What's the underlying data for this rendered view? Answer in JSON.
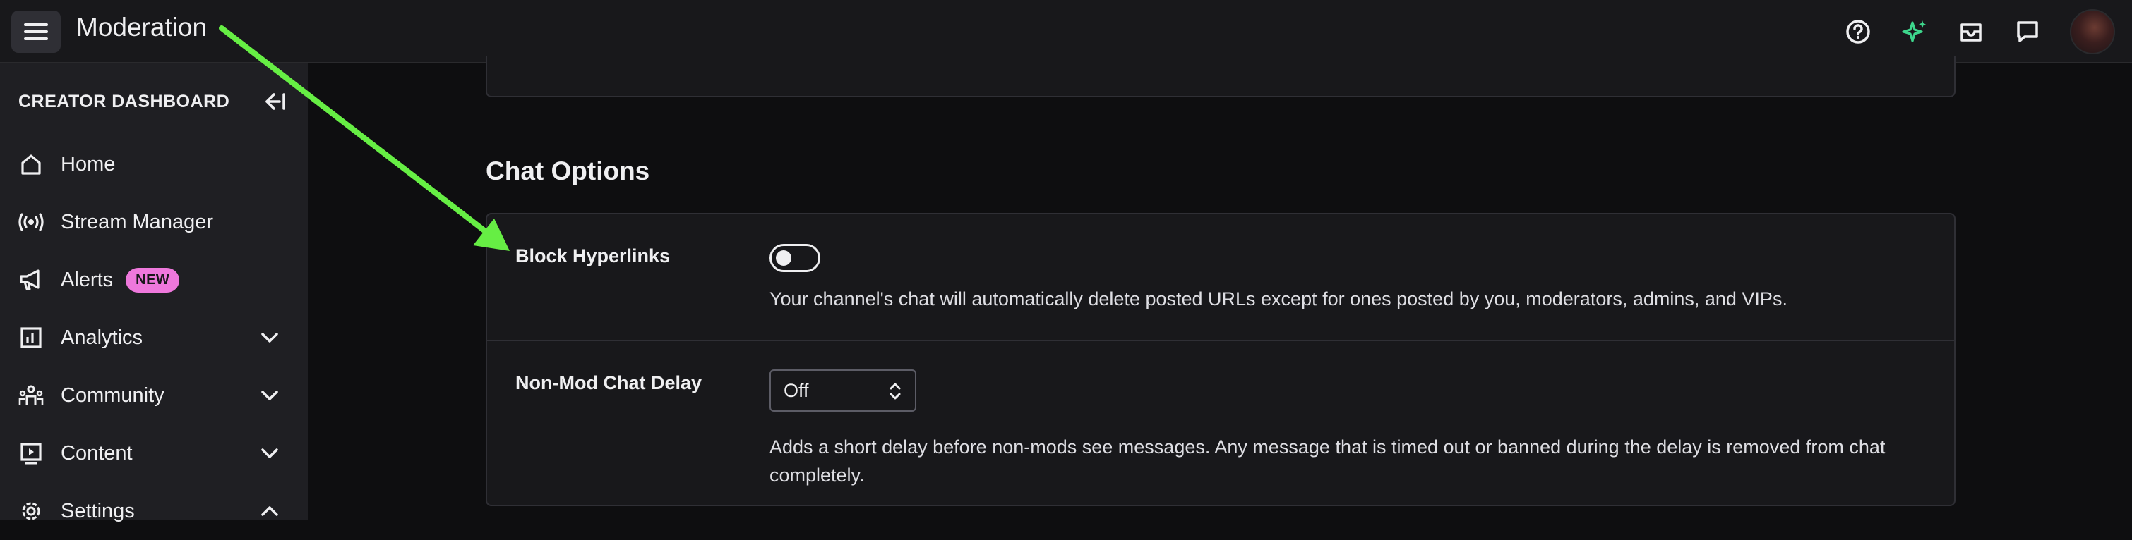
{
  "topbar": {
    "title": "Moderation",
    "icons": [
      "menu-icon",
      "help-icon",
      "sparkle-icon",
      "inbox-icon",
      "whispers-icon",
      "avatar"
    ]
  },
  "sidebar": {
    "title": "CREATOR DASHBOARD",
    "items": [
      {
        "label": "Home",
        "icon": "home-icon"
      },
      {
        "label": "Stream Manager",
        "icon": "broadcast-icon"
      },
      {
        "label": "Alerts",
        "icon": "megaphone-icon",
        "badge": "NEW"
      },
      {
        "label": "Analytics",
        "icon": "analytics-icon",
        "chevron": "down"
      },
      {
        "label": "Community",
        "icon": "community-icon",
        "chevron": "down"
      },
      {
        "label": "Content",
        "icon": "content-icon",
        "chevron": "down"
      },
      {
        "label": "Settings",
        "icon": "gear-icon",
        "chevron": "up"
      }
    ]
  },
  "main": {
    "section_title": "Chat Options",
    "block_hyperlinks": {
      "label": "Block Hyperlinks",
      "toggle_on": false,
      "description": "Your channel's chat will automatically delete posted URLs except for ones posted by you, moderators, admins, and VIPs."
    },
    "chat_delay": {
      "label": "Non-Mod Chat Delay",
      "value": "Off",
      "description_line1": "Adds a short delay before non-mods see messages. Any message that is timed out or banned during the delay is removed from chat",
      "description_line2": "completely."
    }
  },
  "colors": {
    "background": "#0e0e10",
    "sidebar": "#1f1f23",
    "card": "#18181b",
    "badge": "#ee78dc",
    "annotation_arrow": "#66ee44",
    "sparkle": "#3dd68c"
  }
}
